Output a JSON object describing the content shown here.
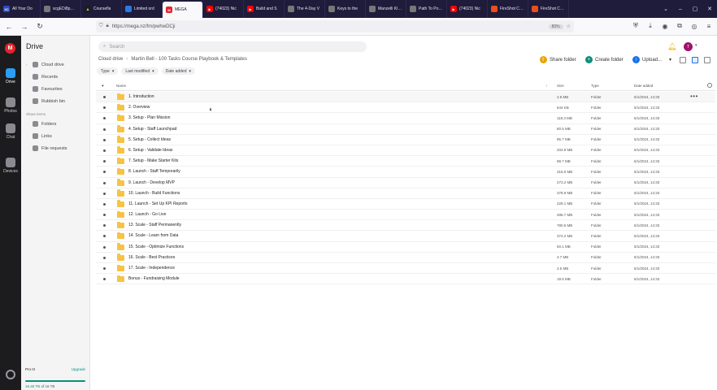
{
  "browser": {
    "tabs": [
      {
        "label": "All Your Do",
        "icon": "xc-icon",
        "color": "#2b4dbf",
        "mark": "XC"
      },
      {
        "label": "scgEDi8pw2U",
        "icon": "page-icon",
        "color": "#777777",
        "mark": ""
      },
      {
        "label": "Coursefla",
        "icon": "coursefla-icon",
        "color": "#1c1c1c",
        "mark": "A"
      },
      {
        "label": "Limited ord",
        "icon": "globe-icon",
        "color": "#2a7ae2",
        "mark": ""
      },
      {
        "label": "MEGA",
        "icon": "mega-icon",
        "color": "#e3242b",
        "mark": "M",
        "active": true
      },
      {
        "label": "(74023) Nic",
        "icon": "youtube-icon",
        "color": "#ff0000",
        "mark": "▶"
      },
      {
        "label": "Build and S",
        "icon": "youtube-icon",
        "color": "#ff0000",
        "mark": "▶"
      },
      {
        "label": "The 4-Day V",
        "icon": "page-icon",
        "color": "#777777",
        "mark": ""
      },
      {
        "label": "Keys to the",
        "icon": "page-icon",
        "color": "#777777",
        "mark": ""
      },
      {
        "label": "Manzelli Klein",
        "icon": "page-icon",
        "color": "#777777",
        "mark": ""
      },
      {
        "label": "Path To Power (",
        "icon": "page-icon",
        "color": "#777777",
        "mark": ""
      },
      {
        "label": "(74023) Nic",
        "icon": "youtube-icon",
        "color": "#ff0000",
        "mark": "▶"
      },
      {
        "label": "FireShot Capture",
        "icon": "fireshot-icon",
        "color": "#e94e1b",
        "mark": ""
      },
      {
        "label": "FireShot Capture",
        "icon": "fireshot-icon",
        "color": "#e94e1b",
        "mark": ""
      }
    ],
    "url": "https://mega.nz/fm/pwhwDCji",
    "zoom": "80%"
  },
  "rail": {
    "items": [
      {
        "label": "Drive",
        "icon": "drive-icon",
        "active": true
      },
      {
        "label": "Photos",
        "icon": "photos-icon"
      },
      {
        "label": "Chat",
        "icon": "chat-icon"
      },
      {
        "label": "Devices",
        "icon": "devices-icon"
      }
    ]
  },
  "sidebar": {
    "title": "Drive",
    "items": [
      {
        "label": "Cloud drive",
        "icon": "cloud-icon"
      },
      {
        "label": "Recents",
        "icon": "clock-icon"
      },
      {
        "label": "Favourites",
        "icon": "heart-icon"
      },
      {
        "label": "Rubbish bin",
        "icon": "trash-icon"
      }
    ],
    "share_section": "Share items",
    "share_items": [
      {
        "label": "Folders",
        "icon": "folder-share-icon"
      },
      {
        "label": "Links",
        "icon": "link-icon"
      },
      {
        "label": "File requests",
        "icon": "file-request-icon"
      }
    ],
    "storage": {
      "plan": "Pro III",
      "upgrade": "Upgrade",
      "used": "16.45 TB",
      "total": "of 16 TB",
      "fraction": 1.0
    }
  },
  "search": {
    "placeholder": "Search"
  },
  "breadcrumb": [
    "Cloud drive",
    "Martin Bell - 100 Tasks Course Playbook & Templates"
  ],
  "actions": {
    "share": "Share folder",
    "create": "Create folder",
    "upload": "Upload..."
  },
  "filters": [
    "Type",
    "Last modified",
    "Date added"
  ],
  "table": {
    "headers": {
      "name": "Name",
      "size": "Size",
      "type": "Type",
      "date": "Date added"
    },
    "rows": [
      {
        "name": "1. Introduction",
        "size": "2.8 MB",
        "type": "Folder",
        "date": "5/1/2024, 14:33",
        "hover": true
      },
      {
        "name": "2. Overview",
        "size": "644 KB",
        "type": "Folder",
        "date": "5/1/2024, 14:33"
      },
      {
        "name": "3. Setup - Plan Mission",
        "size": "118.3 MB",
        "type": "Folder",
        "date": "5/1/2024, 14:33"
      },
      {
        "name": "4. Setup - Staff Launchpad",
        "size": "80.5 MB",
        "type": "Folder",
        "date": "5/1/2024, 14:33"
      },
      {
        "name": "5. Setup - Collect Ideas",
        "size": "95.7 MB",
        "type": "Folder",
        "date": "5/1/2024, 14:33"
      },
      {
        "name": "6. Setup - Validate Ideas",
        "size": "203.9 MB",
        "type": "Folder",
        "date": "5/1/2024, 14:33"
      },
      {
        "name": "7. Setup - Make Starter Kits",
        "size": "98.7 MB",
        "type": "Folder",
        "date": "5/1/2024, 14:33"
      },
      {
        "name": "8. Launch - Staff Temporarily",
        "size": "316.0 MB",
        "type": "Folder",
        "date": "5/1/2024, 14:33"
      },
      {
        "name": "9. Launch - Develop MVP",
        "size": "273.2 MB",
        "type": "Folder",
        "date": "5/1/2024, 14:33"
      },
      {
        "name": "10. Launch - Build Functions",
        "size": "378.9 MB",
        "type": "Folder",
        "date": "5/1/2024, 14:33"
      },
      {
        "name": "11. Launch - Set Up KPI Reports",
        "size": "228.1 MB",
        "type": "Folder",
        "date": "5/1/2024, 14:33"
      },
      {
        "name": "12. Launch - Go Live",
        "size": "486.7 MB",
        "type": "Folder",
        "date": "5/1/2024, 14:33"
      },
      {
        "name": "13. Scale - Staff Permanently",
        "size": "780.5 MB",
        "type": "Folder",
        "date": "5/1/2024, 14:33"
      },
      {
        "name": "14. Scale - Learn from Data",
        "size": "374.2 MB",
        "type": "Folder",
        "date": "5/1/2024, 14:33"
      },
      {
        "name": "15. Scale - Optimize Functions",
        "size": "50.1 MB",
        "type": "Folder",
        "date": "5/1/2024, 14:33"
      },
      {
        "name": "16. Scale - Best Practices",
        "size": "4.7 MB",
        "type": "Folder",
        "date": "5/1/2024, 14:33"
      },
      {
        "name": "17. Scale - Independence",
        "size": "3.5 MB",
        "type": "Folder",
        "date": "5/1/2024, 14:33"
      },
      {
        "name": "Bonus - Fundraising Module",
        "size": "19.5 MB",
        "type": "Folder",
        "date": "5/1/2024, 14:33"
      }
    ]
  },
  "colors": {
    "mega_red": "#e3242b",
    "accent_green": "#0a8f7c",
    "folder_yellow": "#f6c344"
  }
}
